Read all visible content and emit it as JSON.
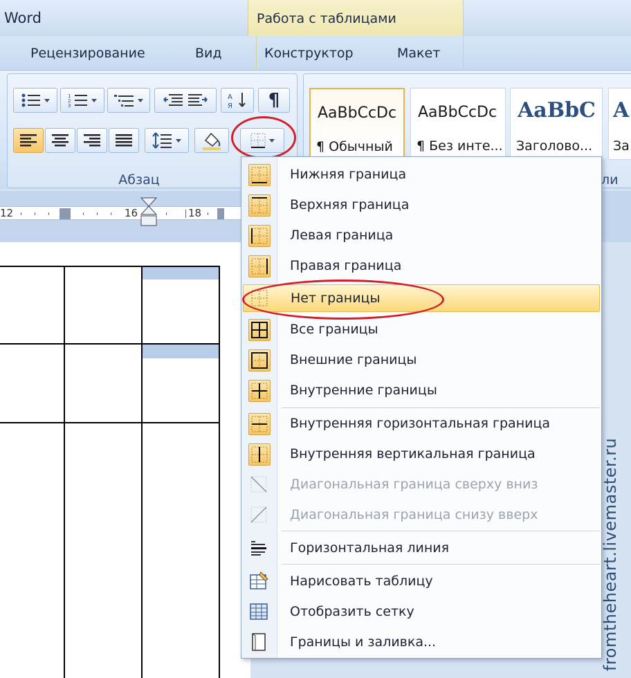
{
  "titlebar": {
    "app_title": "Word",
    "context_title": "Работа с таблицами"
  },
  "ribbon_tabs": [
    "Рецензирование",
    "Вид",
    "Конструктор",
    "Макет"
  ],
  "paragraph_group": {
    "label": "Абзац",
    "pilcrow": "¶"
  },
  "styles_group": {
    "label_partial": "ли",
    "styles": [
      {
        "sample": "AaBbCcDc",
        "name": "¶ Обычный"
      },
      {
        "sample": "AaBbCcDc",
        "name": "¶ Без инте..."
      },
      {
        "sample": "AaBbC",
        "name": "Заголово..."
      },
      {
        "sample": "A",
        "name": "За"
      }
    ]
  },
  "ruler": {
    "numbers": [
      "12",
      "16",
      "18"
    ]
  },
  "borders_menu": {
    "items": [
      {
        "label": "Нижняя граница",
        "enabled": true,
        "icon": "bottom-border-icon"
      },
      {
        "label": "Верхняя граница",
        "enabled": true,
        "icon": "top-border-icon"
      },
      {
        "label": "Левая граница",
        "enabled": true,
        "icon": "left-border-icon"
      },
      {
        "label": "Правая граница",
        "enabled": true,
        "icon": "right-border-icon"
      },
      {
        "label": "Нет границы",
        "enabled": true,
        "icon": "no-border-icon",
        "highlighted": true
      },
      {
        "label": "Все границы",
        "enabled": true,
        "icon": "all-borders-icon"
      },
      {
        "label": "Внешние границы",
        "enabled": true,
        "icon": "outside-borders-icon"
      },
      {
        "label": "Внутренние границы",
        "enabled": true,
        "icon": "inside-borders-icon"
      },
      {
        "label": "Внутренняя горизонтальная граница",
        "enabled": true,
        "icon": "inside-horizontal-border-icon"
      },
      {
        "label": "Внутренняя вертикальная граница",
        "enabled": true,
        "icon": "inside-vertical-border-icon"
      },
      {
        "label": "Диагональная граница сверху вниз",
        "enabled": false,
        "icon": "diagonal-down-border-icon"
      },
      {
        "label": "Диагональная граница снизу вверх",
        "enabled": false,
        "icon": "diagonal-up-border-icon"
      },
      {
        "label": "Горизонтальная линия",
        "enabled": true,
        "icon": "horizontal-line-icon"
      },
      {
        "label": "Нарисовать таблицу",
        "enabled": true,
        "icon": "draw-table-icon"
      },
      {
        "label": "Отобразить сетку",
        "enabled": true,
        "icon": "view-gridlines-icon"
      },
      {
        "label": "Границы и заливка...",
        "enabled": true,
        "icon": "borders-and-shading-icon"
      }
    ]
  },
  "watermark": "fromtheheart.livemaster.ru",
  "colors": {
    "highlight": "#fbd97a",
    "annotation_red": "#d21f2a",
    "ribbon_blue": "#d6e5f6"
  }
}
